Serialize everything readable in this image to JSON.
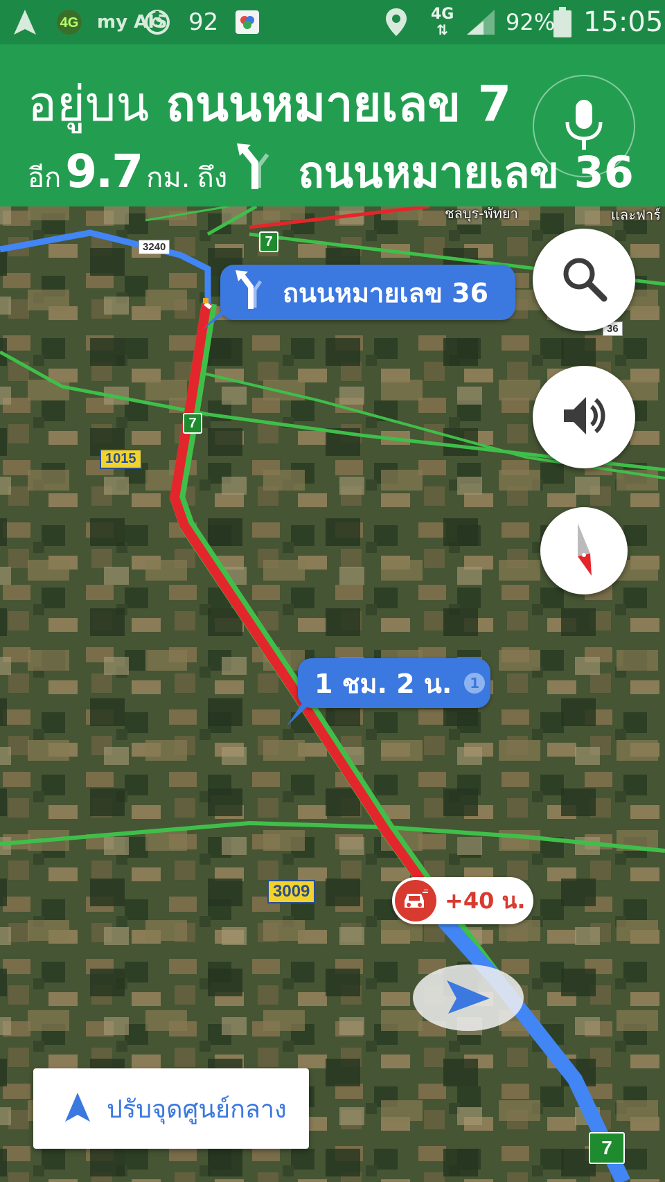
{
  "status_bar": {
    "nav_icon": "navigation-arrow-icon",
    "network_badge": "4G",
    "carrier_logo": "my AIS",
    "data_usage_value": "92",
    "location_icon": "location-pin-icon",
    "network_type": "4G",
    "battery_percent": "92%",
    "time": "15:05"
  },
  "nav": {
    "line1_prefix": "อยู่บน",
    "current_road": "ถนนหมายเลข 7",
    "line2_prefix": "อีก",
    "distance_value": "9.7",
    "distance_unit": "กม.",
    "to_word": "ถึง",
    "next_road": "ถนนหมายเลข 36",
    "turn_icon": "turn-slight-left-icon",
    "mic_icon": "microphone-icon",
    "header_color": "#239e51",
    "status_color": "#1c8a46"
  },
  "map": {
    "turn_callout": "ถนนหมายเลข 36",
    "eta_callout": "1 ชม. 2 น.",
    "eta_info_badge": "1",
    "delay_callout": "+40 น.",
    "place_label_top": "ชลบุร-พัทยา",
    "place_label_right": "และฟาร์",
    "shields": {
      "r3240": "3240",
      "r7_top": "7",
      "r7_mid": "7",
      "r7_bottom": "7",
      "r36": "36",
      "r1015": "1015",
      "r3009": "3009"
    },
    "route_color": "#4285f4",
    "traffic_color": "#e3262b"
  },
  "controls": {
    "search_icon": "search-icon",
    "sound_icon": "speaker-icon",
    "compass_icon": "compass-icon",
    "recenter_label": "ปรับจุดศูนย์กลาง"
  }
}
